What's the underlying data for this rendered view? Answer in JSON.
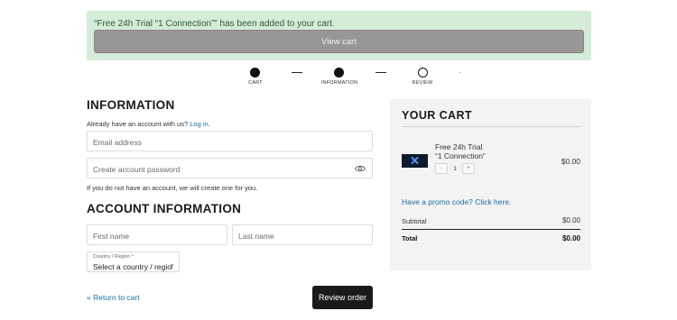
{
  "notice": {
    "message": "“Free 24h Trial “1 Connection”” has been added to your cart.",
    "view_cart_label": "View cart"
  },
  "steps": [
    {
      "label": "CART",
      "state": "done"
    },
    {
      "label": "INFORMATION",
      "state": "done"
    },
    {
      "label": "REVIEW",
      "state": "open"
    }
  ],
  "information": {
    "heading": "INFORMATION",
    "account_prompt": "Already have an account with us?",
    "login_link": "Log in.",
    "email_placeholder": "Email address",
    "password_placeholder": "Create account password",
    "no_account_note": "If you do not have an account, we will create one for you."
  },
  "account_information": {
    "heading": "ACCOUNT INFORMATION",
    "first_name_placeholder": "First name",
    "last_name_placeholder": "Last name",
    "country_label": "Country / Region *",
    "country_value": "Select a country / region"
  },
  "footer": {
    "return_link": "« Return to cart",
    "review_button": "Review order"
  },
  "cart": {
    "title": "YOUR CART",
    "item": {
      "name_line1": "Free 24h Trial",
      "name_line2": "“1 Connection”",
      "quantity": "1",
      "minus": "-",
      "plus": "+",
      "price": "$0.00"
    },
    "promo_link": "Have a promo code? Click here.",
    "subtotal_label": "Subtotal",
    "subtotal_value": "$0.00",
    "total_label": "Total",
    "total_value": "$0.00"
  },
  "colors": {
    "notice_bg": "#d5ecd9",
    "link": "#1b6fa8",
    "primary_button": "#1a1a1a"
  }
}
